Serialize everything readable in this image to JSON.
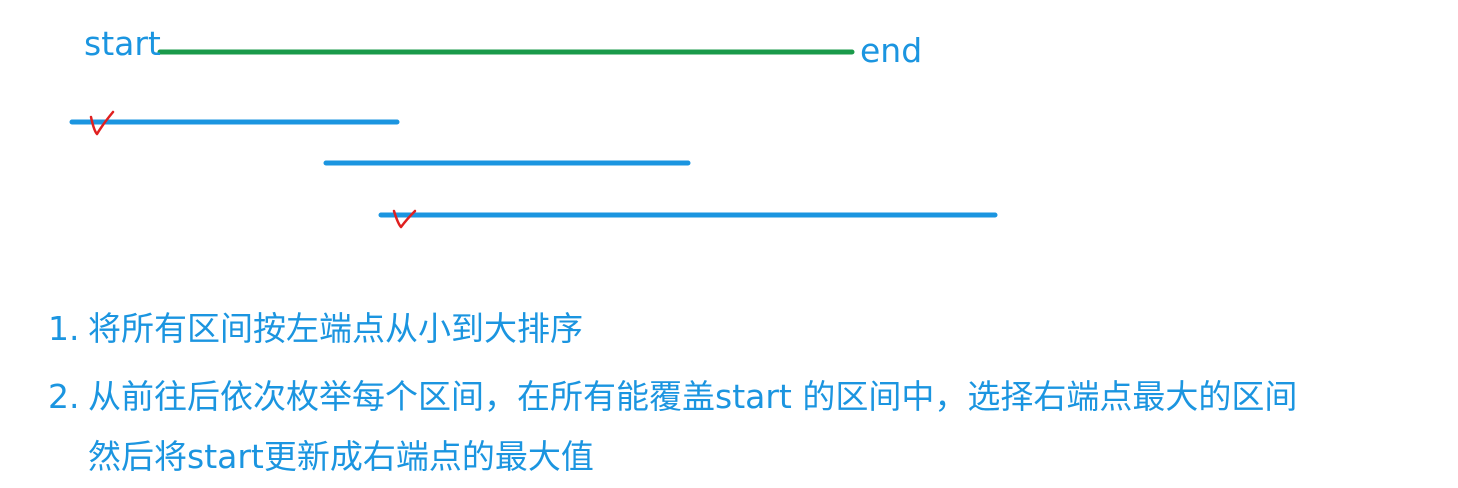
{
  "diagram": {
    "start_label": "start",
    "end_label": "end",
    "target_segment_color": "#1a9a4a",
    "interval_color": "#1b95e0",
    "check_mark_color": "#e02020",
    "intervals": [
      {
        "id": 1,
        "selected": true
      },
      {
        "id": 2,
        "selected": false
      },
      {
        "id": 3,
        "selected": true
      }
    ]
  },
  "steps": [
    {
      "number": "1.",
      "text": "将所有区间按左端点从小到大排序"
    },
    {
      "number": "2.",
      "text": "从前往后依次枚举每个区间，在所有能覆盖start 的区间中，选择右端点最大的区间",
      "continuation": "然后将start更新成右端点的最大值"
    }
  ]
}
